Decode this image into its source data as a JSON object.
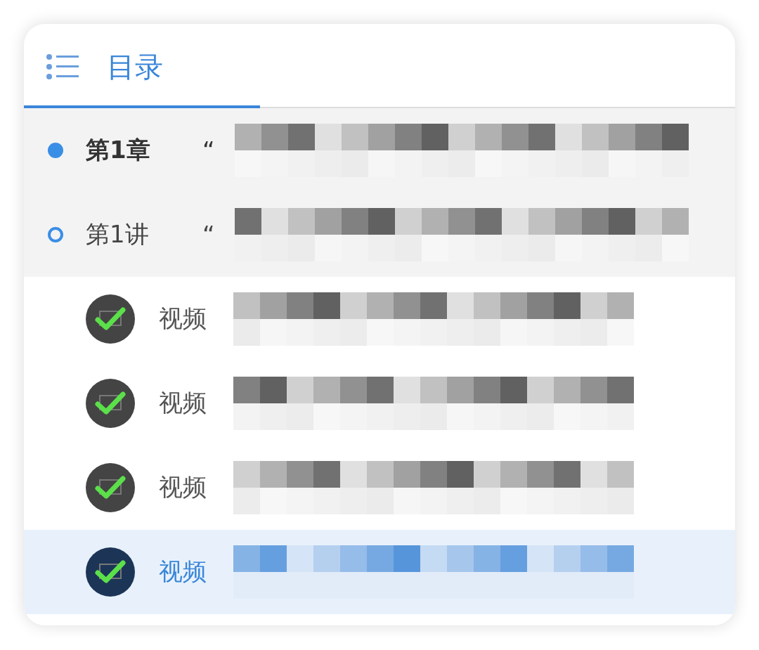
{
  "tabs": [
    {
      "label": "目录",
      "selected": true
    }
  ],
  "chapter": {
    "number": "第1章",
    "title": "“",
    "kind": "chapter"
  },
  "lesson": {
    "number": "第1讲",
    "title": "“",
    "kind": "lesson"
  },
  "videos": [
    {
      "label": "视频",
      "completed": true,
      "selected": false
    },
    {
      "label": "视频",
      "completed": true,
      "selected": false
    },
    {
      "label": "视频",
      "completed": true,
      "selected": false
    },
    {
      "label": "视频",
      "completed": true,
      "selected": true
    }
  ]
}
